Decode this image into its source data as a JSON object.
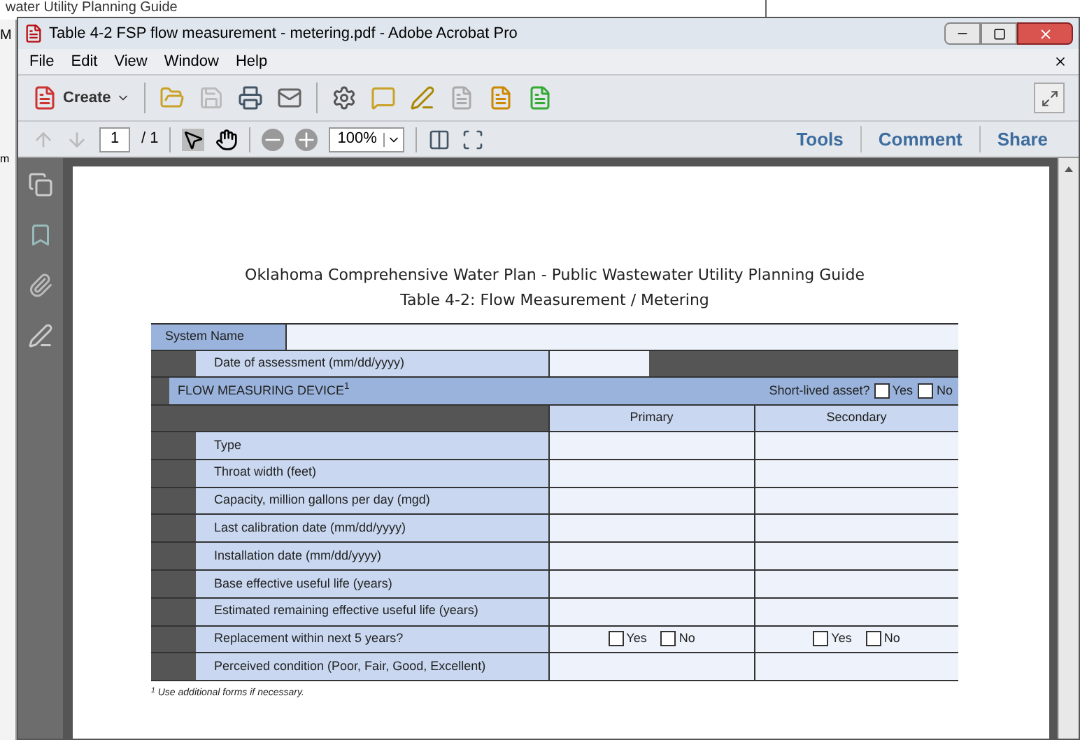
{
  "background_window": {
    "title": "water Utility Planning Guide",
    "letters": [
      "M",
      "m"
    ]
  },
  "window": {
    "title": "Table 4-2 FSP flow measurement - metering.pdf - Adobe Acrobat Pro"
  },
  "menu": [
    "File",
    "Edit",
    "View",
    "Window",
    "Help"
  ],
  "toolbar": {
    "create": "Create"
  },
  "nav": {
    "page": "1",
    "pages": "/ 1",
    "zoom": "100%",
    "tabs": [
      "Tools",
      "Comment",
      "Share"
    ]
  },
  "document": {
    "title": "Oklahoma Comprehensive Water Plan - Public Wastewater Utility Planning Guide",
    "subtitle": "Table 4-2: Flow Measurement / Metering",
    "system_name": "System Name",
    "date_label": "Date of assessment (mm/dd/yyyy)",
    "section": "FLOW MEASURING DEVICE$^{1}$",
    "short_lived": {
      "label": "Short-lived asset?",
      "yes": {
        "label": "Yes",
        "checked": false
      },
      "no": {
        "label": "No",
        "checked": false
      }
    },
    "columns": [
      "Primary",
      "Secondary"
    ],
    "rows": [
      {
        "kind": "text",
        "label": "Type"
      },
      {
        "kind": "text",
        "label": "Throat width (feet)"
      },
      {
        "kind": "text",
        "label": "Capacity, million gallons per day (mgd)"
      },
      {
        "kind": "text",
        "label": "Last calibration date (mm/dd/yyyy)"
      },
      {
        "kind": "text",
        "label": "Installation date (mm/dd/yyyy)"
      },
      {
        "kind": "text",
        "label": "Base effective useful life (years)"
      },
      {
        "kind": "text",
        "label": "Estimated remaining effective useful life (years)"
      },
      {
        "kind": "yesno",
        "label": "Replacement within next 5 years?",
        "options": [
          [
            {
              "label": "Yes",
              "checked": false
            },
            {
              "label": "No",
              "checked": false
            }
          ],
          [
            {
              "label": "Yes",
              "checked": false
            },
            {
              "label": "No",
              "checked": false
            }
          ]
        ]
      },
      {
        "kind": "text",
        "label": "Perceived condition (Poor, Fair, Good, Excellent)"
      }
    ],
    "footnote": "$^{1}$ Use additional forms if necessary."
  }
}
